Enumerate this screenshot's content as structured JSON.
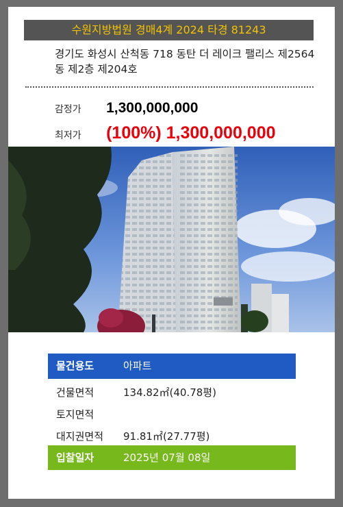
{
  "case_title": "수원지방법원 경매4계 2024 타경 81243",
  "address": "경기도 화성시 산척동 718 동탄 더 레이크 팰리스 제2564동 제2층 제204호",
  "appraisal": {
    "label": "감정가",
    "value": "1,300,000,000"
  },
  "minimum_bid": {
    "label": "최저가",
    "value": "(100%) 1,300,000,000"
  },
  "photo": {
    "icon": "apartment-building-photo"
  },
  "details": {
    "usage": {
      "label": "물건용도",
      "value": "아파트"
    },
    "building_area": {
      "label": "건물면적",
      "value": "134.82㎡(40.78평)"
    },
    "land_area": {
      "label": "토지면적",
      "value": ""
    },
    "land_rights_area": {
      "label": "대지권면적",
      "value": "91.81㎡(27.77평)"
    },
    "bid_date": {
      "label": "입찰일자",
      "value": "2025년 07월 08일"
    }
  },
  "colors": {
    "background": "#6e6e6e",
    "title_bar": "#545454",
    "title_text": "#f2c300",
    "minimum_price": "#e8000b",
    "usage_row": "#1f5bc2",
    "bid_date_row": "#77b81d"
  }
}
